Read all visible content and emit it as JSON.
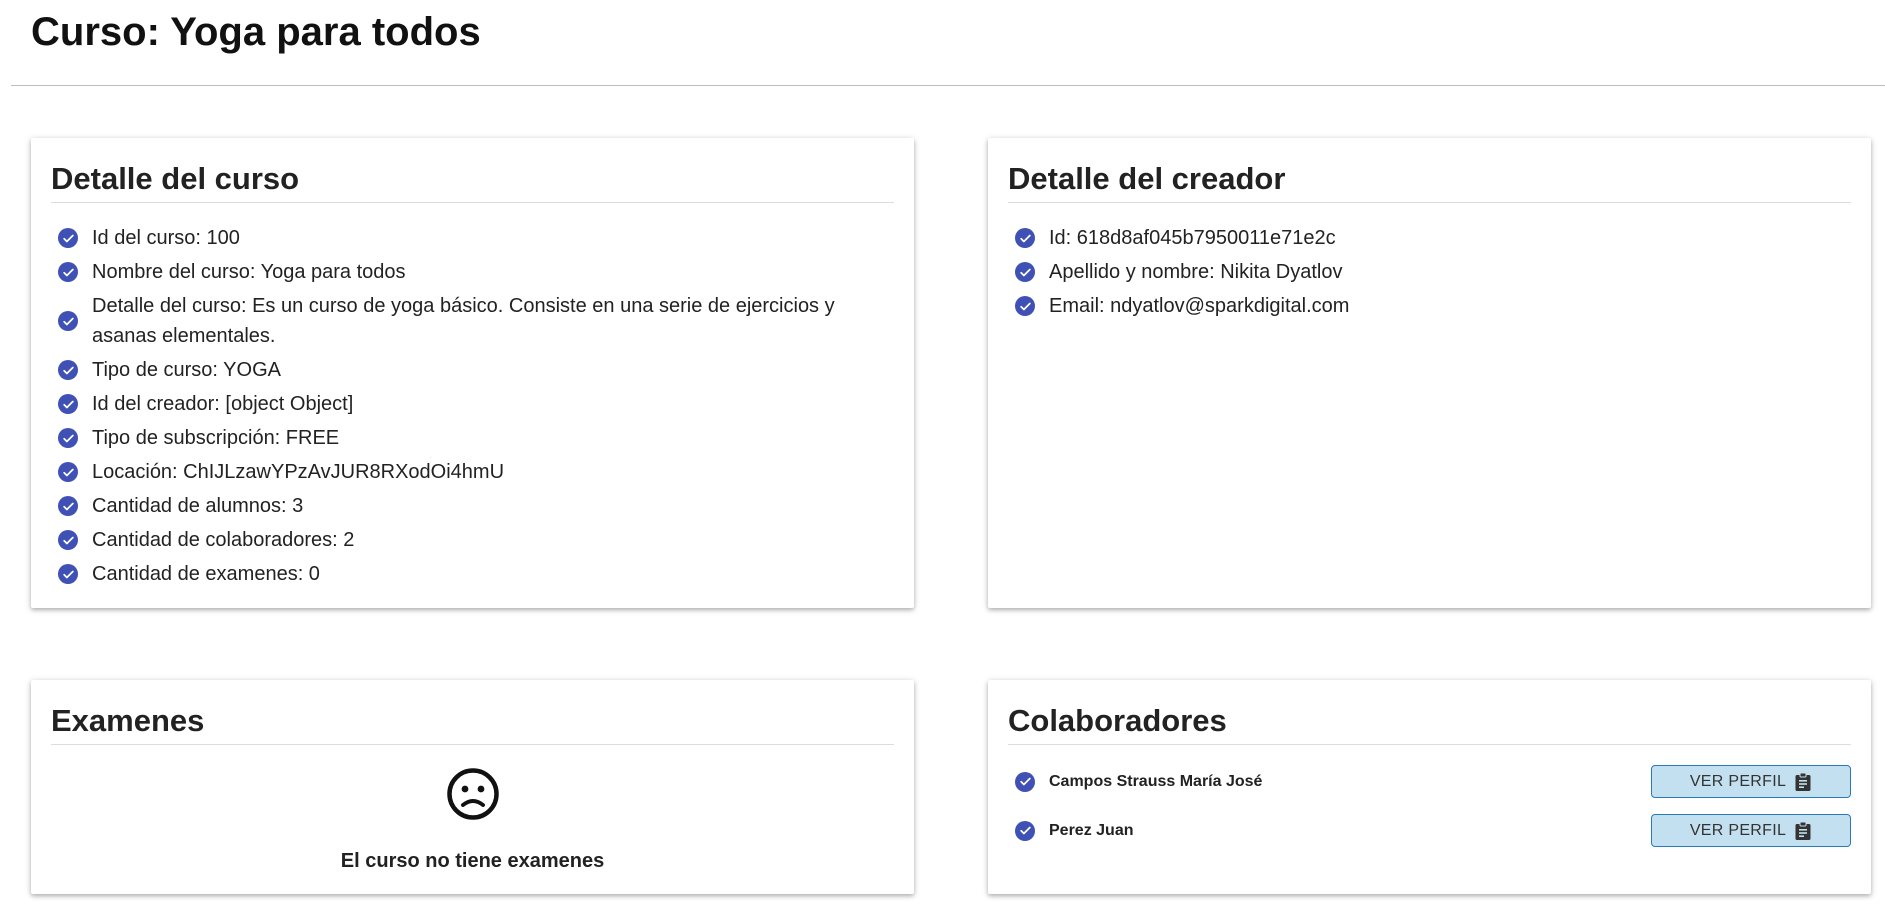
{
  "header": {
    "title": "Curso: Yoga para todos"
  },
  "course_detail": {
    "title": "Detalle del curso",
    "items": [
      "Id del curso: 100",
      "Nombre del curso: Yoga para todos",
      "Detalle del curso: Es un curso de yoga básico. Consiste en una serie de ejercicios y asanas elementales.",
      "Tipo de curso: YOGA",
      "Id del creador: [object Object]",
      "Tipo de subscripción: FREE",
      "Locación: ChIJLzawYPzAvJUR8RXodOi4hmU",
      "Cantidad de alumnos: 3",
      "Cantidad de colaboradores: 2",
      "Cantidad de examenes: 0"
    ]
  },
  "creator_detail": {
    "title": "Detalle del creador",
    "items": [
      "Id: 618d8af045b7950011e71e2c",
      "Apellido y nombre: Nikita Dyatlov",
      "Email: ndyatlov@sparkdigital.com"
    ]
  },
  "exams": {
    "title": "Examenes",
    "empty_icon": "sad-face-icon",
    "empty_text": "El curso no tiene examenes"
  },
  "collaborators": {
    "title": "Colaboradores",
    "items": [
      {
        "name": "Campos Strauss María José",
        "button_label": "VER PERFIL"
      },
      {
        "name": "Perez Juan",
        "button_label": "VER PERFIL"
      }
    ]
  },
  "colors": {
    "check_accent": "#3f51b5",
    "button_bg": "#c3e0f0",
    "button_border": "#2a7ab5"
  }
}
